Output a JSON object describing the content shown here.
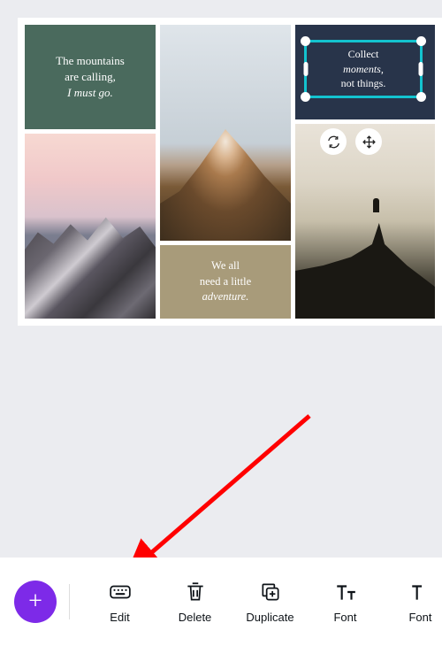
{
  "canvas": {
    "tile_green": {
      "line1": "The mountains",
      "line2": "are calling,",
      "line3": "I must go."
    },
    "tile_beige": {
      "line1": "We all",
      "line2": "need a little",
      "line3": "adventure."
    },
    "tile_navy": {
      "line1": "Collect",
      "line2": "moments,",
      "line3": "not things."
    }
  },
  "toolbar": {
    "items": [
      {
        "label": "Edit"
      },
      {
        "label": "Delete"
      },
      {
        "label": "Duplicate"
      },
      {
        "label": "Font"
      },
      {
        "label": "Font"
      }
    ]
  },
  "colors": {
    "accent": "#7d2ae8",
    "selection": "#13c3cf",
    "tile_green": "#4a6a5d",
    "tile_beige": "#a89b7a",
    "tile_navy": "#28344a"
  }
}
